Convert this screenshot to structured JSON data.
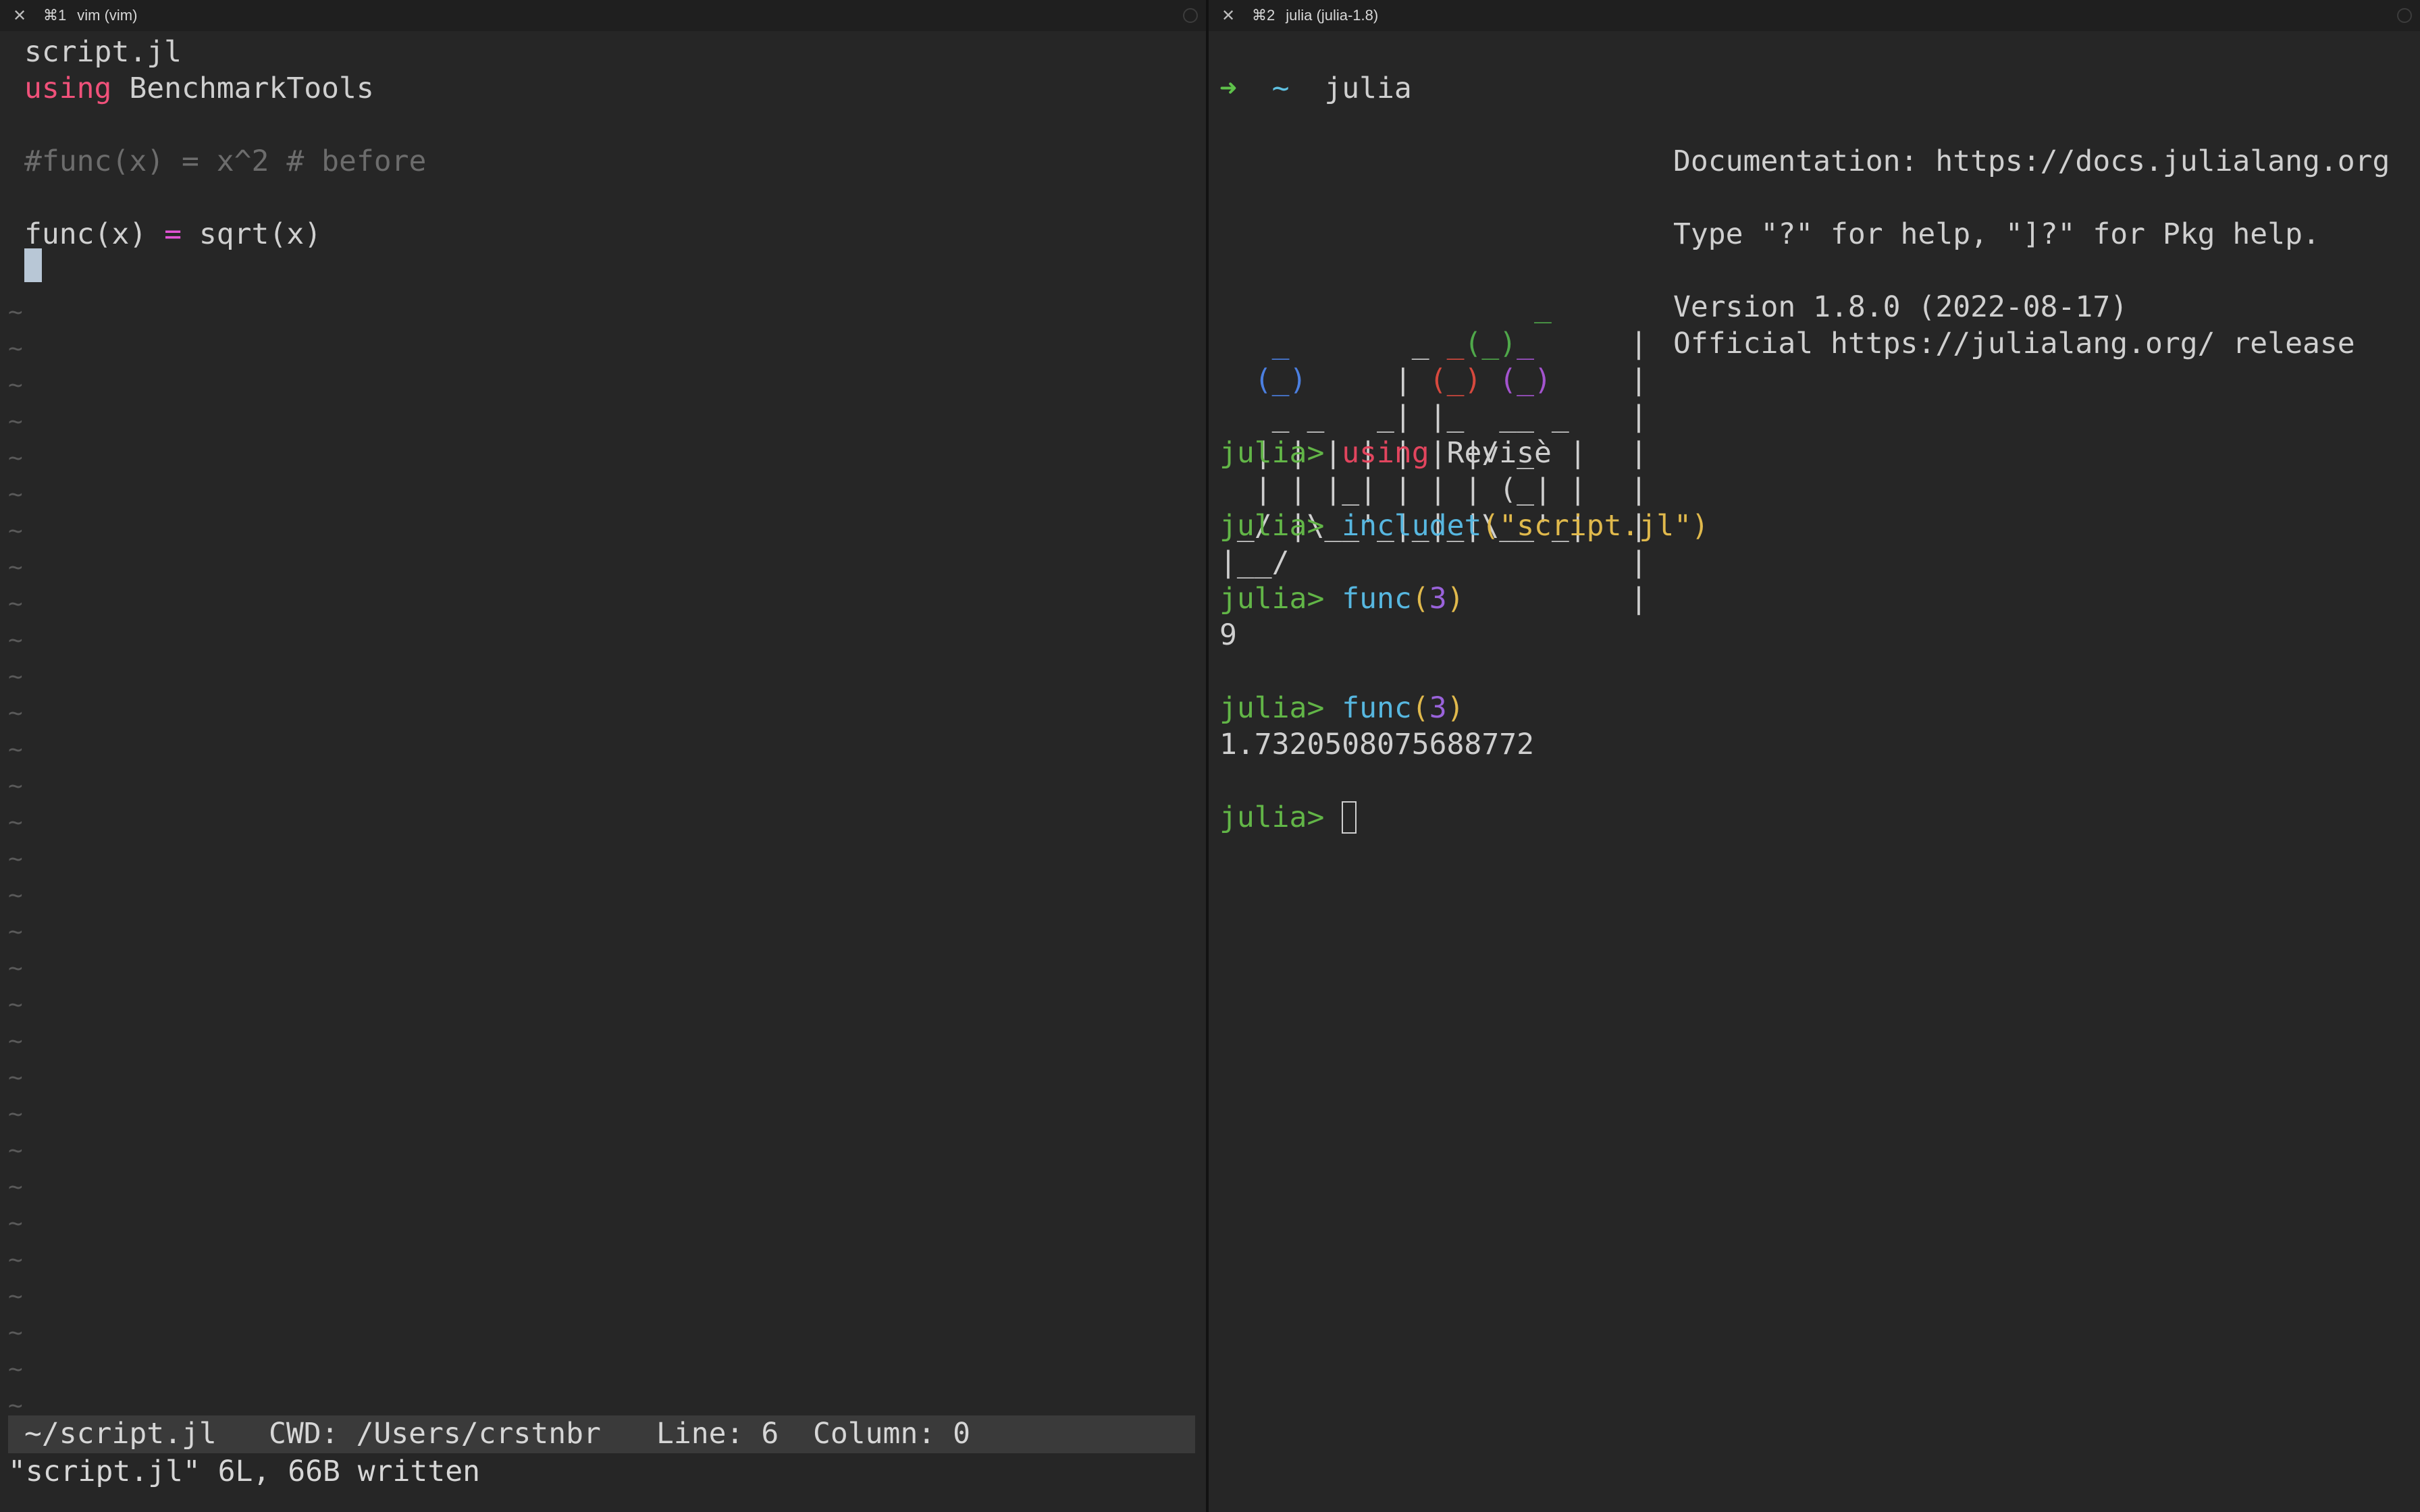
{
  "left_tab": {
    "close_glyph": "✕",
    "num": "⌘1",
    "title": "vim (vim)"
  },
  "right_tab": {
    "close_glyph": "✕",
    "num": "⌘2",
    "title": "julia (julia-1.8)"
  },
  "vim": {
    "filename": "script.jl",
    "lines": [
      {
        "kw": "using",
        "rest": " BenchmarkTools"
      },
      {
        "comment": "#func(x) = x^2 # before"
      },
      {
        "a": "func(x) ",
        "op": "=",
        "b": " sqrt(x)"
      }
    ],
    "tilde": "~",
    "status": {
      "file": "~/script.jl",
      "cwd": "CWD: /Users/crstnbr",
      "line": "Line: 6",
      "column": "Column: 0"
    },
    "cmdline": "\"script.jl\" 6L, 66B written"
  },
  "julia": {
    "shell_arrow": "➜",
    "shell_dir": "~",
    "shell_cmd": "julia",
    "banner": {
      "row0": "_",
      "row1a": "_",
      "row1b": "_ ",
      "row1c": "_",
      "row1d": "(_)",
      "row1e": "_",
      "row2a": "(_)",
      "row2b": "|",
      "row2c": "(_)",
      "row2d": "(_)",
      "row3": " _ _   _| |_  __ _",
      "row4": "| | | | | | |/ _` |",
      "row5": "| | |_| | | | (_| |",
      "row6": "_/ |\\__'_|_|_|\\__'_|",
      "row7": "|__/",
      "sep": "|"
    },
    "info": {
      "docs": "Documentation: https://docs.julialang.org",
      "help": "Type \"?\" for help, \"]?\" for Pkg help.",
      "version": "Version 1.8.0 (2022-08-17)",
      "official": "Official https://julialang.org/ release"
    },
    "prompt": "julia>",
    "cmd1_kw": "using",
    "cmd1_rest": "Revise",
    "cmd2_fn": "includet",
    "cmd2_open": "(",
    "cmd2_str": "\"script.jl\"",
    "cmd2_close": ")",
    "cmd3_fn": "func",
    "cmd3_open": "(",
    "cmd3_arg": "3",
    "cmd3_close": ")",
    "out1": "9",
    "out2": "1.7320508075688772"
  }
}
